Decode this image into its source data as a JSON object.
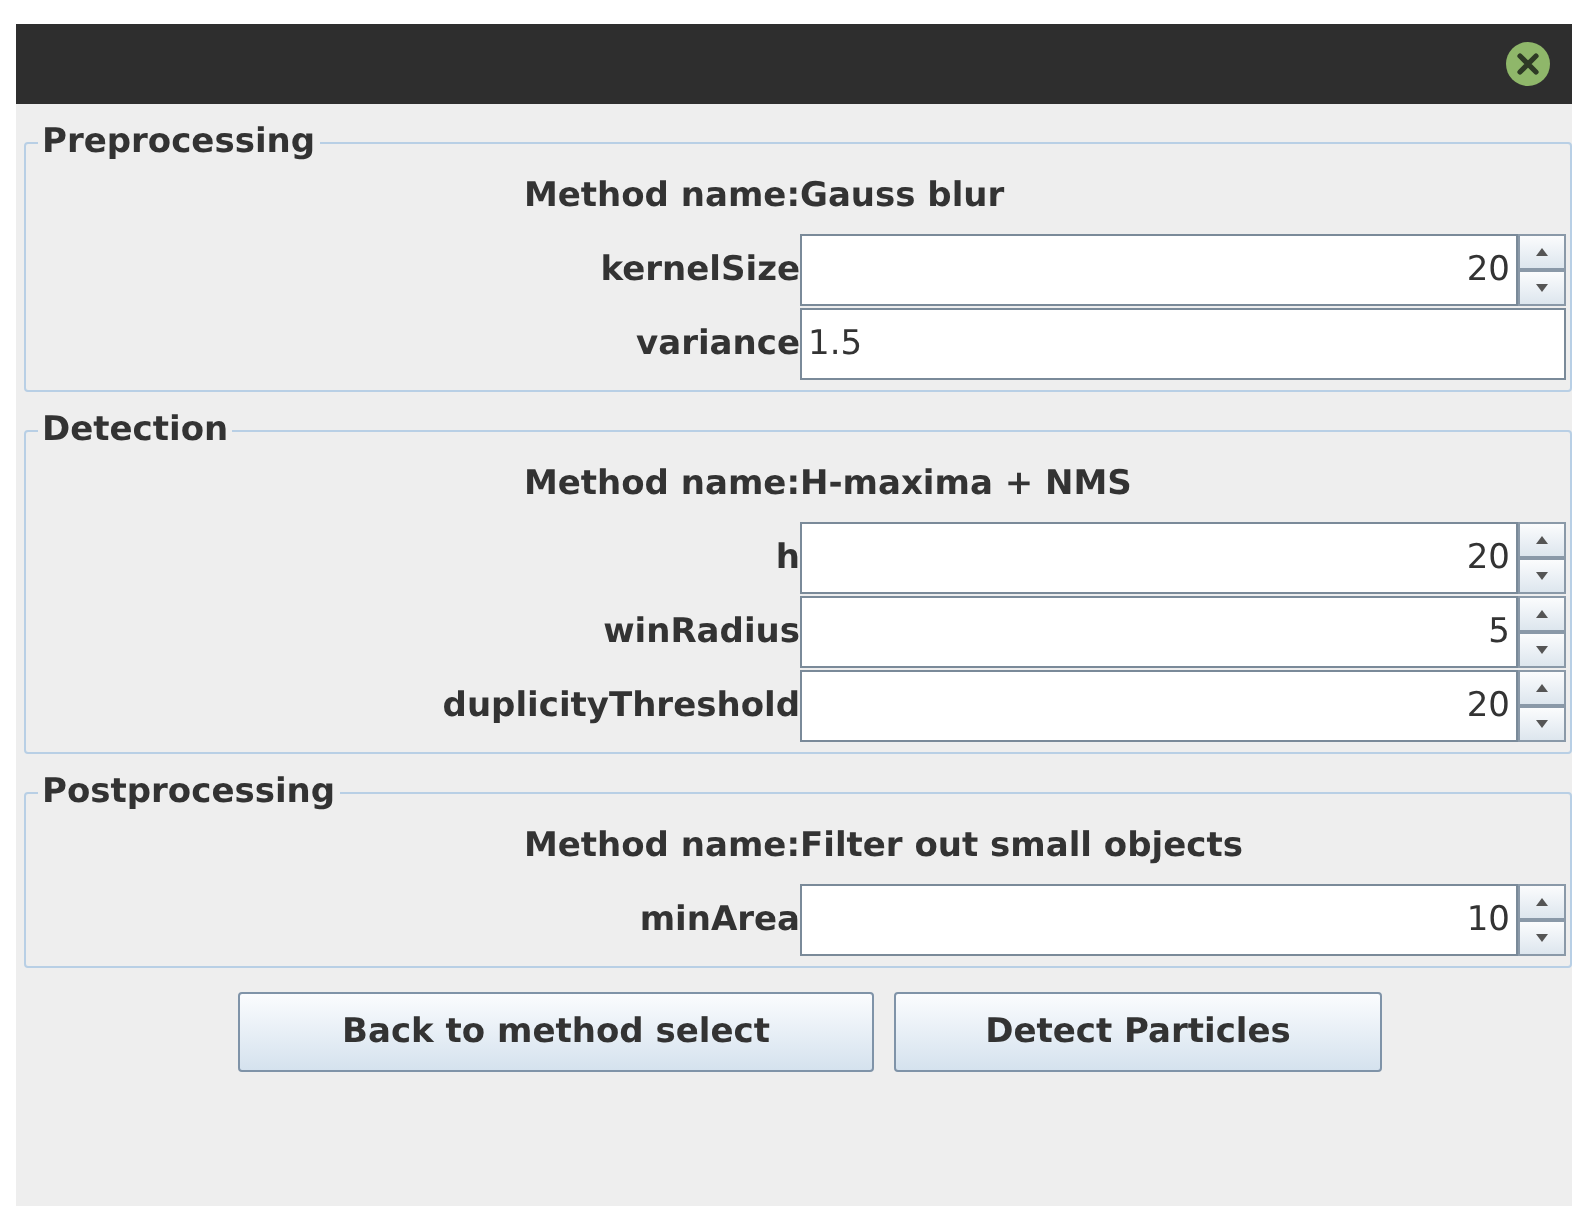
{
  "sections": [
    {
      "title": "Preprocessing",
      "method_label": "Method name:",
      "method": "Gauss blur",
      "params": [
        {
          "label": "kernelSize",
          "value": "20",
          "kind": "spinner"
        },
        {
          "label": "variance",
          "value": "1.5",
          "kind": "text"
        }
      ]
    },
    {
      "title": "Detection",
      "method_label": "Method name:",
      "method": "H-maxima + NMS",
      "params": [
        {
          "label": "h",
          "value": "20",
          "kind": "spinner"
        },
        {
          "label": "winRadius",
          "value": "5",
          "kind": "spinner"
        },
        {
          "label": "duplicityThreshold",
          "value": "20",
          "kind": "spinner"
        }
      ]
    },
    {
      "title": "Postprocessing",
      "method_label": "Method name:",
      "method": "Filter out small objects",
      "params": [
        {
          "label": "minArea",
          "value": "10",
          "kind": "spinner"
        }
      ]
    }
  ],
  "buttons": [
    "Back to method select",
    "Detect Particles"
  ]
}
